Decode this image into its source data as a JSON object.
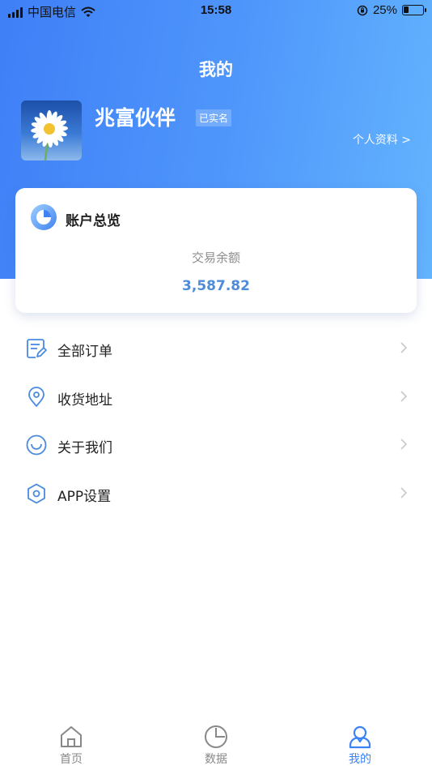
{
  "status_bar": {
    "carrier": "中国电信",
    "time": "15:58",
    "battery": "25%",
    "battery_level": 0.25
  },
  "header": {
    "title": "我的",
    "username": "兆富伙伴",
    "verified_badge": "已实名",
    "profile_link": "个人资料 >"
  },
  "account_card": {
    "title": "账户总览",
    "balance_label": "交易余额",
    "balance_value": "3,587.82"
  },
  "menu": {
    "items": [
      {
        "label": "全部订单",
        "icon": "order-list-icon"
      },
      {
        "label": "收货地址",
        "icon": "location-pin-icon"
      },
      {
        "label": "关于我们",
        "icon": "smile-icon"
      },
      {
        "label": "APP设置",
        "icon": "hexagon-settings-icon"
      }
    ]
  },
  "tabbar": {
    "tabs": [
      {
        "label": "首页",
        "icon": "home-icon",
        "active": false
      },
      {
        "label": "数据",
        "icon": "pie-chart-icon",
        "active": false
      },
      {
        "label": "我的",
        "icon": "user-icon",
        "active": true
      }
    ]
  },
  "colors": {
    "header_gradient_start": "#3f7ff7",
    "header_gradient_end": "#63b4fe",
    "accent": "#4e8bd9",
    "tab_active": "#3b82f6"
  }
}
